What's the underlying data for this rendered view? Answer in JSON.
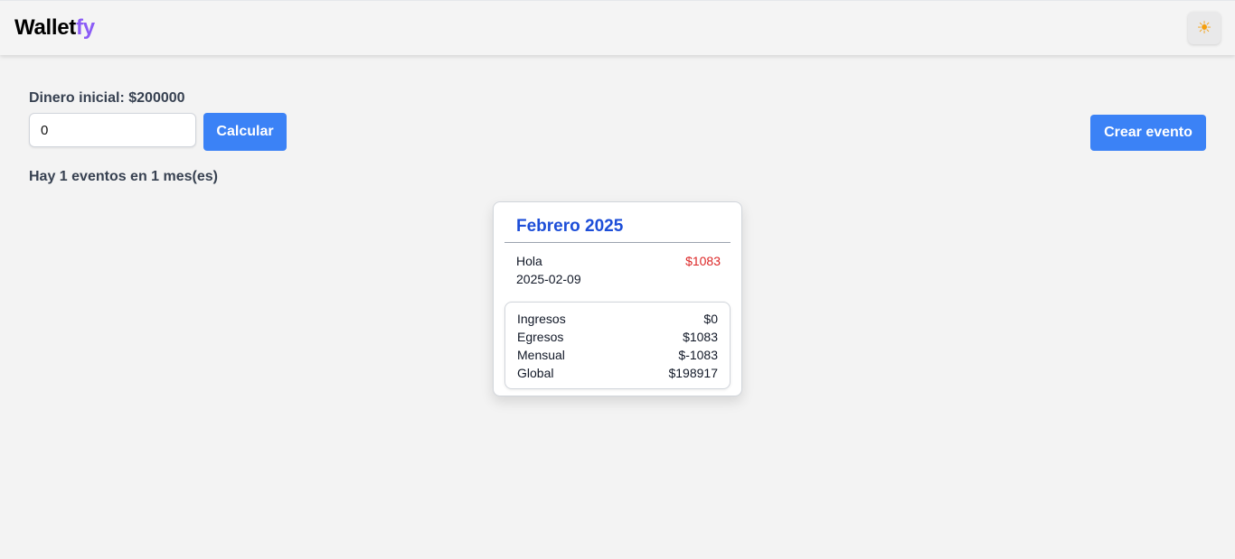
{
  "app": {
    "brand_main": "Wallet",
    "brand_accent": "fy",
    "theme_icon": "☀"
  },
  "controls": {
    "initial_label": "Dinero inicial: $200000",
    "amount_value": "0",
    "calculate_label": "Calcular",
    "create_event_label": "Crear evento"
  },
  "summary": "Hay 1 eventos en 1 mes(es)",
  "months": [
    {
      "title": "Febrero 2025",
      "events": [
        {
          "name": "Hola",
          "amount": "$1083",
          "date": "2025-02-09"
        }
      ],
      "totals": [
        {
          "label": "Ingresos",
          "value": "$0"
        },
        {
          "label": "Egresos",
          "value": "$1083"
        },
        {
          "label": "Mensual",
          "value": "$-1083"
        },
        {
          "label": "Global",
          "value": "$198917"
        }
      ]
    }
  ],
  "colors": {
    "accent": "#8b5cf6",
    "primary": "#3b82f6",
    "month_title": "#1d4ed8",
    "expense": "#dc2626",
    "theme_icon": "#f59e0b"
  }
}
